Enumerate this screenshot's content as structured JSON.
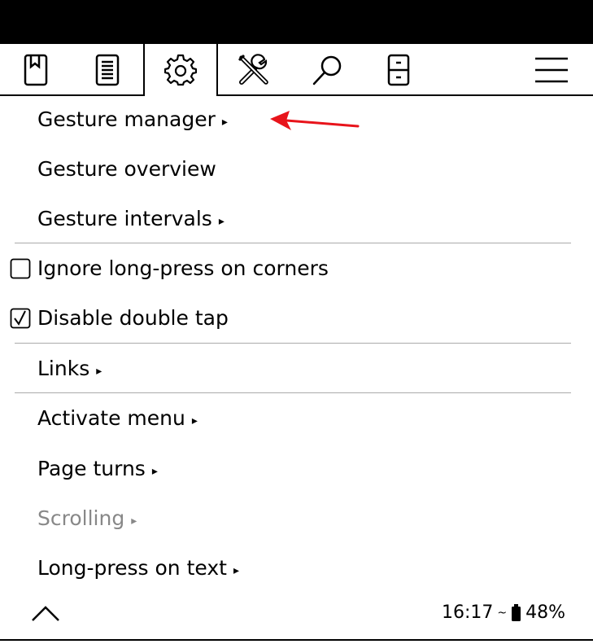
{
  "tabs": [
    {
      "icon": "bookmark-book-icon"
    },
    {
      "icon": "document-list-icon"
    },
    {
      "icon": "gear-icon",
      "active": true
    },
    {
      "icon": "tools-icon"
    },
    {
      "icon": "search-icon"
    },
    {
      "icon": "file-cabinet-icon"
    },
    {
      "icon": "hamburger-menu-icon"
    }
  ],
  "menu": {
    "items": [
      {
        "label": "Gesture manager",
        "submenu": true
      },
      {
        "label": "Gesture overview",
        "submenu": false
      },
      {
        "label": "Gesture intervals",
        "submenu": true
      },
      {
        "label": "Ignore long-press on corners",
        "checkbox": true,
        "checked": false
      },
      {
        "label": "Disable double tap",
        "checkbox": true,
        "checked": true
      },
      {
        "label": "Links",
        "submenu": true
      },
      {
        "label": "Activate menu",
        "submenu": true
      },
      {
        "label": "Page turns",
        "submenu": true
      },
      {
        "label": "Scrolling",
        "submenu": true,
        "disabled": true
      },
      {
        "label": "Long-press on text",
        "submenu": true
      }
    ],
    "submenu_marker": "▸",
    "checkbox_unchecked": "☐",
    "checkbox_checked": "☑"
  },
  "status": {
    "time": "16:17",
    "battery": "48%",
    "wifi_glyph": "~"
  },
  "annotation": {
    "color": "#e8141b",
    "icon": "red-arrow-annotation"
  }
}
